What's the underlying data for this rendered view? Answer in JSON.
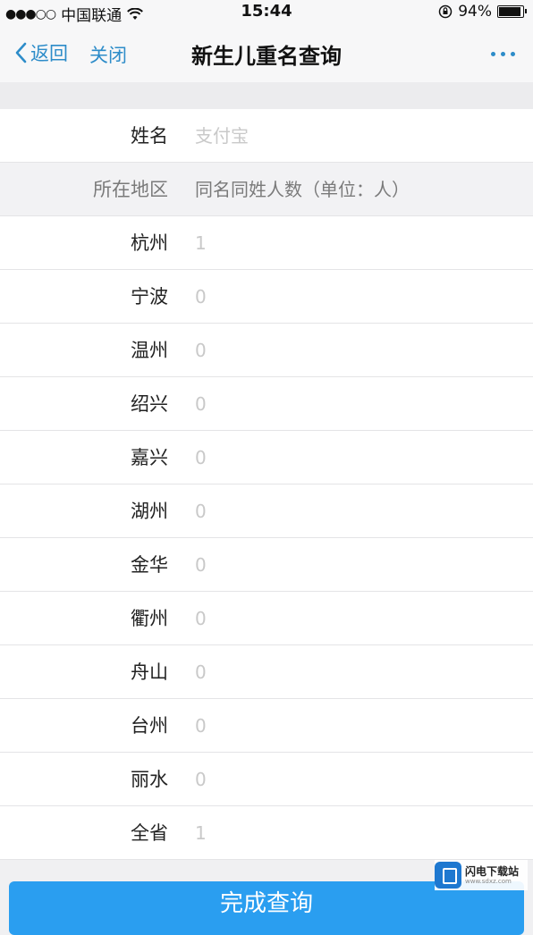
{
  "status_bar": {
    "signal": "●●●○○",
    "carrier": "中国联通",
    "time": "15:44",
    "battery": "94%",
    "battery_level": 0.94
  },
  "nav": {
    "back_label": "返回",
    "close_label": "关闭",
    "title": "新生儿重名查询"
  },
  "form": {
    "name_label": "姓名",
    "name_placeholder": "支付宝",
    "header": {
      "region_label": "所在地区",
      "count_label": "同名同姓人数（单位：人）"
    },
    "rows": [
      {
        "city": "杭州",
        "count": "1"
      },
      {
        "city": "宁波",
        "count": "0"
      },
      {
        "city": "温州",
        "count": "0"
      },
      {
        "city": "绍兴",
        "count": "0"
      },
      {
        "city": "嘉兴",
        "count": "0"
      },
      {
        "city": "湖州",
        "count": "0"
      },
      {
        "city": "金华",
        "count": "0"
      },
      {
        "city": "衢州",
        "count": "0"
      },
      {
        "city": "舟山",
        "count": "0"
      },
      {
        "city": "台州",
        "count": "0"
      },
      {
        "city": "丽水",
        "count": "0"
      },
      {
        "city": "全省",
        "count": "1"
      }
    ]
  },
  "submit_label": "完成查询",
  "watermark": {
    "title": "闪电下载站",
    "subtitle": "www.sdxz.com"
  },
  "colors": {
    "accent": "#2d8cc9",
    "button": "#2a9ef0"
  }
}
